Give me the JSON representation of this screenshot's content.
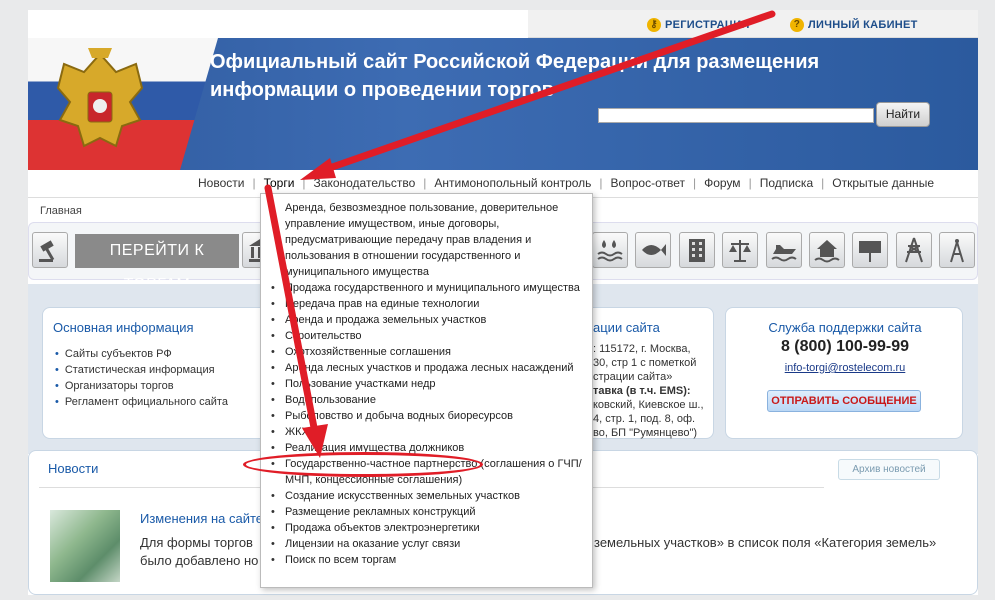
{
  "top_links": {
    "register": "РЕГИСТРАЦИЯ",
    "cabinet": "ЛИЧНЫЙ КАБИНЕТ"
  },
  "header": {
    "title_line1": "Официальный сайт Российской Федерации для размещения",
    "title_line2": "информации о проведении торгов",
    "search_button": "Найти"
  },
  "nav": {
    "items": [
      "Новости",
      "Торги",
      "Законодательство",
      "Антимонопольный контроль",
      "Вопрос-ответ",
      "Форум",
      "Подписка",
      "Открытые данные"
    ]
  },
  "breadcrumb": "Главная",
  "goto_button": "ПЕРЕЙТИ К ТОРГАМ",
  "main_info": {
    "title": "Основная информация",
    "items": [
      "Сайты субъектов РФ",
      "Статистическая информация",
      "Организаторы торгов",
      "Регламент официального сайта"
    ]
  },
  "contacts": {
    "title": "ации сайта",
    "lines": [
      ": 115172, г. Москва,",
      "30, стр 1 с пометкой",
      "страции сайта»",
      "тавка (в т.ч. EMS):",
      "ковский, Киевское ш.,",
      "4, стр. 1, под. 8, оф.",
      "во, БП \"Румянцево\")"
    ]
  },
  "support": {
    "title": "Служба поддержки сайта",
    "phone": "8 (800) 100-99-99",
    "email": "info-torgi@rostelecom.ru",
    "send_button": "ОТПРАВИТЬ СООБЩЕНИЕ"
  },
  "news": {
    "title": "Новости",
    "archive_button": "Архив новостей",
    "headline": "Изменения на сайте",
    "text_left": "Для формы торгов",
    "text_left2": "было добавлено но",
    "text_right": "земельных участков» в список поля «Категория земель»"
  },
  "dropdown": {
    "items": [
      "Аренда, безвозмездное пользование, доверительное управление имуществом, иные договоры, предусматривающие передачу прав владения и пользования в отношении государственного и муниципального имущества",
      "Продажа государственного и муниципального имущества",
      "Передача прав на единые технологии",
      "Аренда и продажа земельных участков",
      "Строительство",
      "Охотхозяйственные соглашения",
      "Аренда лесных участков и продажа лесных насаждений",
      "Пользование участками недр",
      "Водопользование",
      "Рыболовство и добыча водных биоресурсов",
      "ЖКХ",
      "Реализация имущества должников",
      "Государственно-частное партнерство (соглашения о ГЧП/МЧП, концессионные соглашения)",
      "Создание искусственных земельных участков",
      "Размещение рекламных конструкций",
      "Продажа объектов электроэнергетики",
      "Лицензии на оказание услуг связи",
      "Поиск по всем торгам"
    ]
  },
  "colors": {
    "header_blue": "#2f5a9e",
    "link_blue": "#1a5aa8",
    "arrow_red": "#e01d27"
  }
}
